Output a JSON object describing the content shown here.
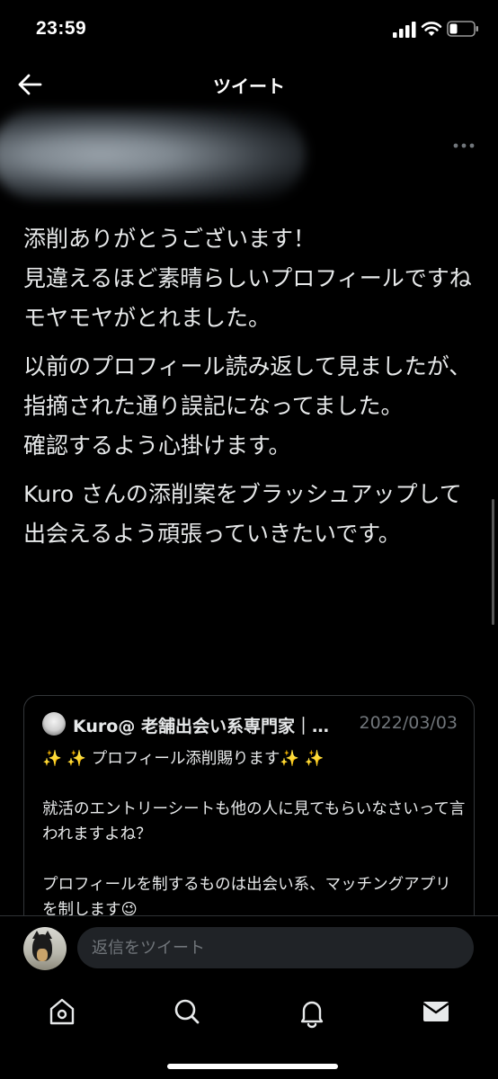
{
  "status_bar": {
    "time": "23:59"
  },
  "header": {
    "title": "ツイート"
  },
  "tweet": {
    "paragraphs": [
      "添削ありがとうございます！\n見違えるほど素晴らしいプロフィールですね\nモヤモヤがとれました。",
      "以前のプロフィール読み返して見ましたが、指摘された通り誤記になってました。\n確認するよう心掛けます。",
      "Kuro さんの添削案をブラッシュアップして出会えるよう頑張っていきたいです。"
    ]
  },
  "quoted_tweet": {
    "author_name": "Kuro@ 老舗出会い系専門家｜…",
    "date": "2022/03/03",
    "text": "✨ ✨ プロフィール添削賜ります✨ ✨\n\n就活のエントリーシートも他の人に見てもらいなさいって言われますよね？\n\nプロフィールを制するものは出会い系、マッチングアプリを制します😉"
  },
  "reply": {
    "placeholder": "返信をツイート"
  },
  "tabs": [
    {
      "name": "home-icon"
    },
    {
      "name": "search-icon"
    },
    {
      "name": "notifications-icon"
    },
    {
      "name": "messages-icon"
    }
  ]
}
